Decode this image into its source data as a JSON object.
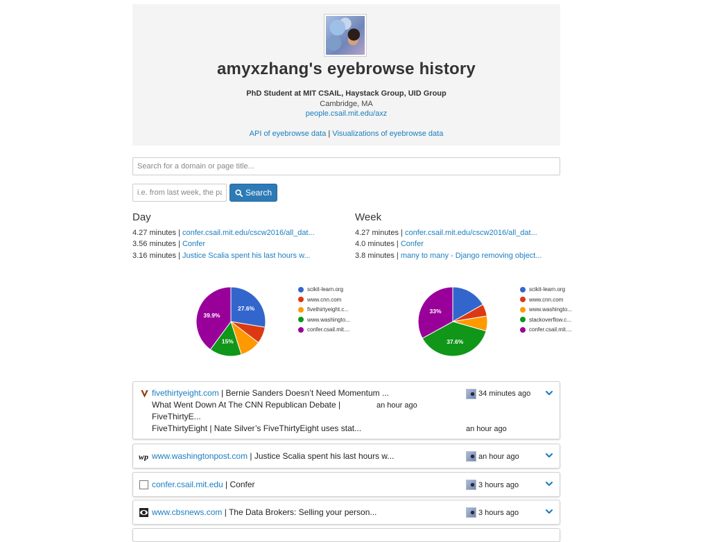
{
  "header": {
    "title": "amyxzhang's eyebrowse history",
    "subtitle": "PhD Student at MIT CSAIL, Haystack Group, UID Group",
    "location": "Cambridge, MA",
    "profile_link": "people.csail.mit.edu/axz",
    "api_link": "API of eyebrowse data",
    "separator": " | ",
    "viz_link": "Visualizations of eyebrowse data"
  },
  "search": {
    "placeholder": "Search for a domain or page title...",
    "date_placeholder": "i.e. from last week, the past month",
    "button_label": "Search",
    "button_icon": "search-icon"
  },
  "stats": {
    "day": {
      "title": "Day",
      "items": [
        {
          "value": "4.27 minutes",
          "sep": " | ",
          "link": "confer.csail.mit.edu/cscw2016/all_dat..."
        },
        {
          "value": "3.56 minutes",
          "sep": " | ",
          "link": "Confer"
        },
        {
          "value": "3.16 minutes",
          "sep": " | ",
          "link": "Justice Scalia spent his last hours w..."
        }
      ]
    },
    "week": {
      "title": "Week",
      "items": [
        {
          "value": "4.27 minutes",
          "sep": " | ",
          "link": "confer.csail.mit.edu/cscw2016/all_dat..."
        },
        {
          "value": "4.0 minutes",
          "sep": " | ",
          "link": "Confer"
        },
        {
          "value": "3.8 minutes",
          "sep": " | ",
          "link": "many to many - Django removing object..."
        }
      ]
    }
  },
  "chart_data": [
    {
      "type": "pie",
      "title": "",
      "categories": [
        "scikit-learn.org",
        "www.cnn.com",
        "fivethirtyeight.c...",
        "www.washingto...",
        "confer.csail.mit...."
      ],
      "values": [
        27.6,
        7.8,
        9.7,
        15.0,
        39.9
      ],
      "labels": [
        "27.6%",
        "",
        "",
        "15%",
        "39.9%"
      ],
      "colors": [
        "#3366cc",
        "#dc3912",
        "#ff9900",
        "#109618",
        "#990099"
      ],
      "legend": "right"
    },
    {
      "type": "pie",
      "title": "",
      "categories": [
        "scikit-learn.org",
        "www.cnn.com",
        "www.washingto...",
        "stackoverflow.c...",
        "confer.csail.mit...."
      ],
      "values": [
        16.8,
        5.6,
        7.0,
        37.6,
        33.0
      ],
      "labels": [
        "",
        "",
        "",
        "37.6%",
        "33%"
      ],
      "colors": [
        "#3366cc",
        "#dc3912",
        "#ff9900",
        "#109618",
        "#990099"
      ],
      "legend": "right"
    }
  ],
  "feed": [
    {
      "icon": "fivethirtyeight-icon",
      "domain": "fivethirtyeight.com",
      "sep": " | ",
      "title": "Bernie Sanders Doesn’t Need Momentum ...",
      "time": "34 minutes ago",
      "subitems": [
        {
          "title_line1": "What Went Down At The CNN Republican Debate  |",
          "title_line2": "FiveThirtyE...",
          "time": "an hour ago"
        },
        {
          "title": "FiveThirtyEight | Nate Silver’s FiveThirtyEight uses stat...",
          "time": "an hour ago"
        }
      ]
    },
    {
      "icon": "washington-post-icon",
      "domain": "www.washingtonpost.com",
      "sep": " | ",
      "title": "Justice Scalia spent his last hours w...",
      "time": "an hour ago"
    },
    {
      "icon": "blank-page-icon",
      "domain": "confer.csail.mit.edu",
      "sep": " | ",
      "title": "Confer",
      "time": "3 hours ago"
    },
    {
      "icon": "cbs-news-icon",
      "domain": "www.cbsnews.com",
      "sep": " | ",
      "title": "The Data Brokers: Selling your person...",
      "time": "3 hours ago"
    }
  ]
}
